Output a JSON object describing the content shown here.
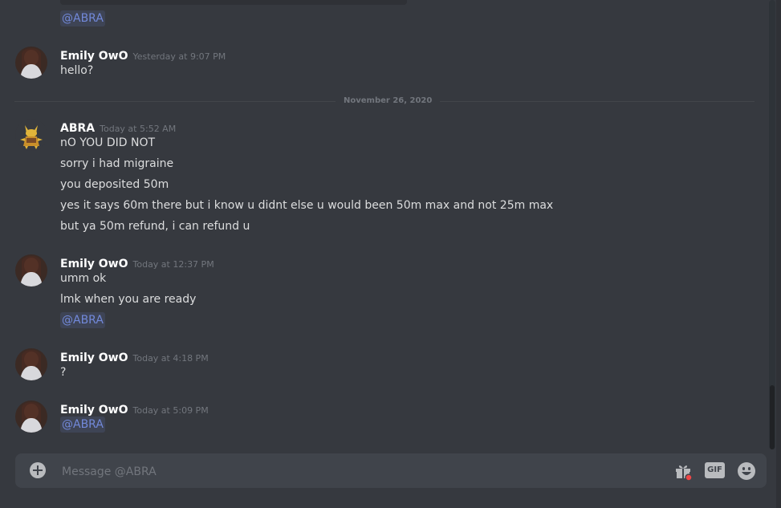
{
  "top_mention": "@ABRA",
  "date_divider": "November 26, 2020",
  "messages": [
    {
      "username": "Emily OwO",
      "timestamp": "Yesterday at 9:07 PM",
      "lines": [
        "hello?"
      ]
    },
    {
      "username": "ABRA",
      "timestamp": "Today at 5:52 AM",
      "lines": [
        "nO YOU DID NOT",
        "sorry i had migraine",
        "you deposited 50m",
        "yes it says 60m there but i know u didnt else u would been 50m max and not 25m max",
        "but ya 50m refund, i can refund u"
      ]
    },
    {
      "username": "Emily OwO",
      "timestamp": "Today at 12:37 PM",
      "lines": [
        "umm ok",
        "lmk when you are ready"
      ],
      "mention": "@ABRA"
    },
    {
      "username": "Emily OwO",
      "timestamp": "Today at 4:18 PM",
      "lines": [
        "?"
      ]
    },
    {
      "username": "Emily OwO",
      "timestamp": "Today at 5:09 PM",
      "mention": "@ABRA"
    }
  ],
  "composer": {
    "placeholder": "Message @ABRA",
    "gif_label": "GIF"
  },
  "colors": {
    "background": "#36393f",
    "mention": "#7289da",
    "username": "#ffffff",
    "timestamp": "#72767d",
    "unread_dot": "#f04747"
  },
  "icons": [
    "add-attachment-icon",
    "gift-icon",
    "gif-icon",
    "emoji-icon"
  ]
}
